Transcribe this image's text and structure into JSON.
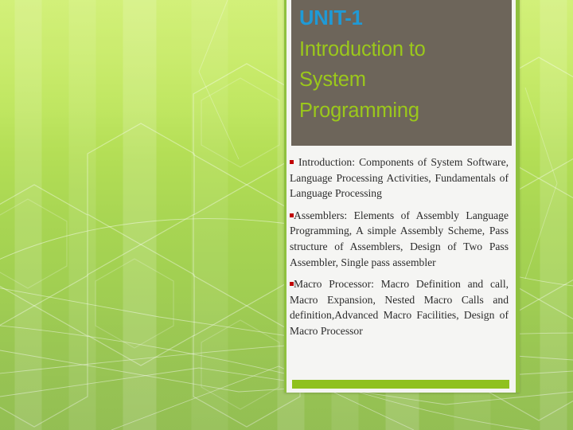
{
  "slide": {
    "title_block": {
      "unit_label": "UNIT-1",
      "subtitle_lines": [
        "Introduction to",
        "System",
        "Programming"
      ]
    },
    "body": {
      "bullet_color": "#c00000",
      "paragraphs": [
        {
          "marker": "square-bullet",
          "spaced_marker": true,
          "text": "Introduction: Components of System Software, Language Processing Activities, Fundamentals of Language Processing"
        },
        {
          "marker": "square-bullet",
          "spaced_marker": false,
          "text": "Assemblers: Elements of Assembly Language Programming, A simple Assembly Scheme, Pass structure of Assemblers, Design of Two Pass Assembler, Single pass assembler"
        },
        {
          "marker": "square-bullet",
          "spaced_marker": false,
          "text": "Macro Processor: Macro Definition and call, Macro Expansion, Nested Macro Calls and definition,Advanced Macro Facilities, Design of Macro Processor"
        }
      ]
    },
    "accent_bar": {
      "color": "#8fc11e"
    },
    "theme": {
      "title_block_color": "#6d655a",
      "unit_text_color": "#1f9ad6",
      "subtitle_text_color": "#9bc81b",
      "panel_background": "#f5f5f3",
      "panel_border_color": "#8fc13f",
      "background_top_color": "#cdee6a",
      "background_bottom_color": "#99c656"
    }
  }
}
